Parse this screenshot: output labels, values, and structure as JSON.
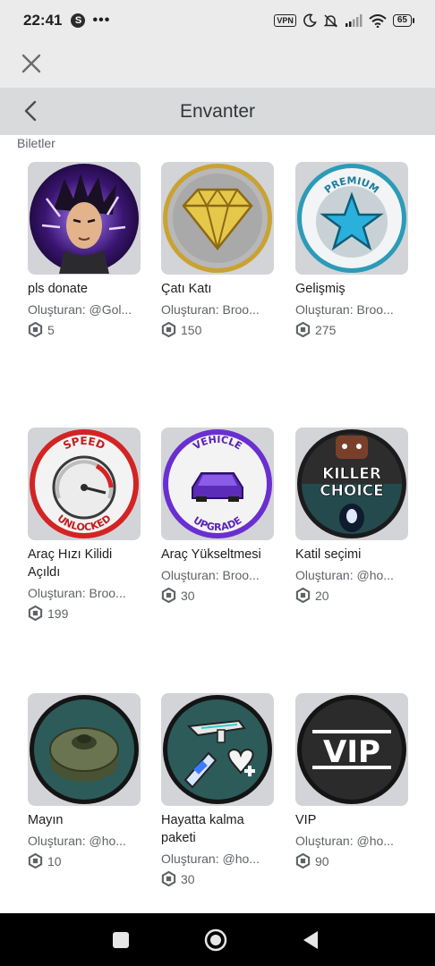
{
  "status_bar": {
    "time": "22:41",
    "s_badge": "S",
    "dots": "•••",
    "vpn": "VPN",
    "battery": "65"
  },
  "header": {
    "title": "Envanter"
  },
  "section": {
    "label": "Biletler"
  },
  "creator_prefix": "Oluşturan:",
  "items": [
    {
      "name": "pls donate",
      "creator": "Oluşturan: @Gol...",
      "price": "5",
      "icon": "goku-portrait-icon"
    },
    {
      "name": "Çatı Katı",
      "creator": "Oluşturan: Broo...",
      "price": "150",
      "icon": "gold-diamond-icon"
    },
    {
      "name": "Gelişmiş",
      "creator": "Oluşturan: Broo...",
      "price": "275",
      "icon": "premium-star-icon",
      "badge_text": "PREMIUM"
    },
    {
      "name": "Araç Hızı Kilidi Açıldı",
      "creator": "Oluşturan: Broo...",
      "price": "199",
      "icon": "speedometer-icon",
      "badge_top": "SPEED",
      "badge_bottom": "UNLOCKED"
    },
    {
      "name": "Araç Yükseltmesi",
      "creator": "Oluşturan: Broo...",
      "price": "30",
      "icon": "purple-car-icon",
      "badge_top": "VEHICLE",
      "badge_bottom": "UPGRADE"
    },
    {
      "name": "Katil seçimi",
      "creator": "Oluşturan: @ho...",
      "price": "20",
      "icon": "killer-choice-icon",
      "badge_top": "KILLER",
      "badge_bottom": "CHOICE"
    },
    {
      "name": "Mayın",
      "creator": "Oluşturan: @ho...",
      "price": "10",
      "icon": "landmine-icon"
    },
    {
      "name": "Hayatta kalma paketi",
      "creator": "Oluşturan: @ho...",
      "price": "30",
      "icon": "survival-pack-icon"
    },
    {
      "name": "VIP",
      "creator": "Oluşturan: @ho...",
      "price": "90",
      "icon": "vip-icon",
      "badge_text": "VIP"
    }
  ],
  "colors": {
    "card_bg": "#d3d4d8",
    "header_bg": "#d8dadc",
    "status_bg": "#ebebeb",
    "muted_text": "#606368"
  }
}
